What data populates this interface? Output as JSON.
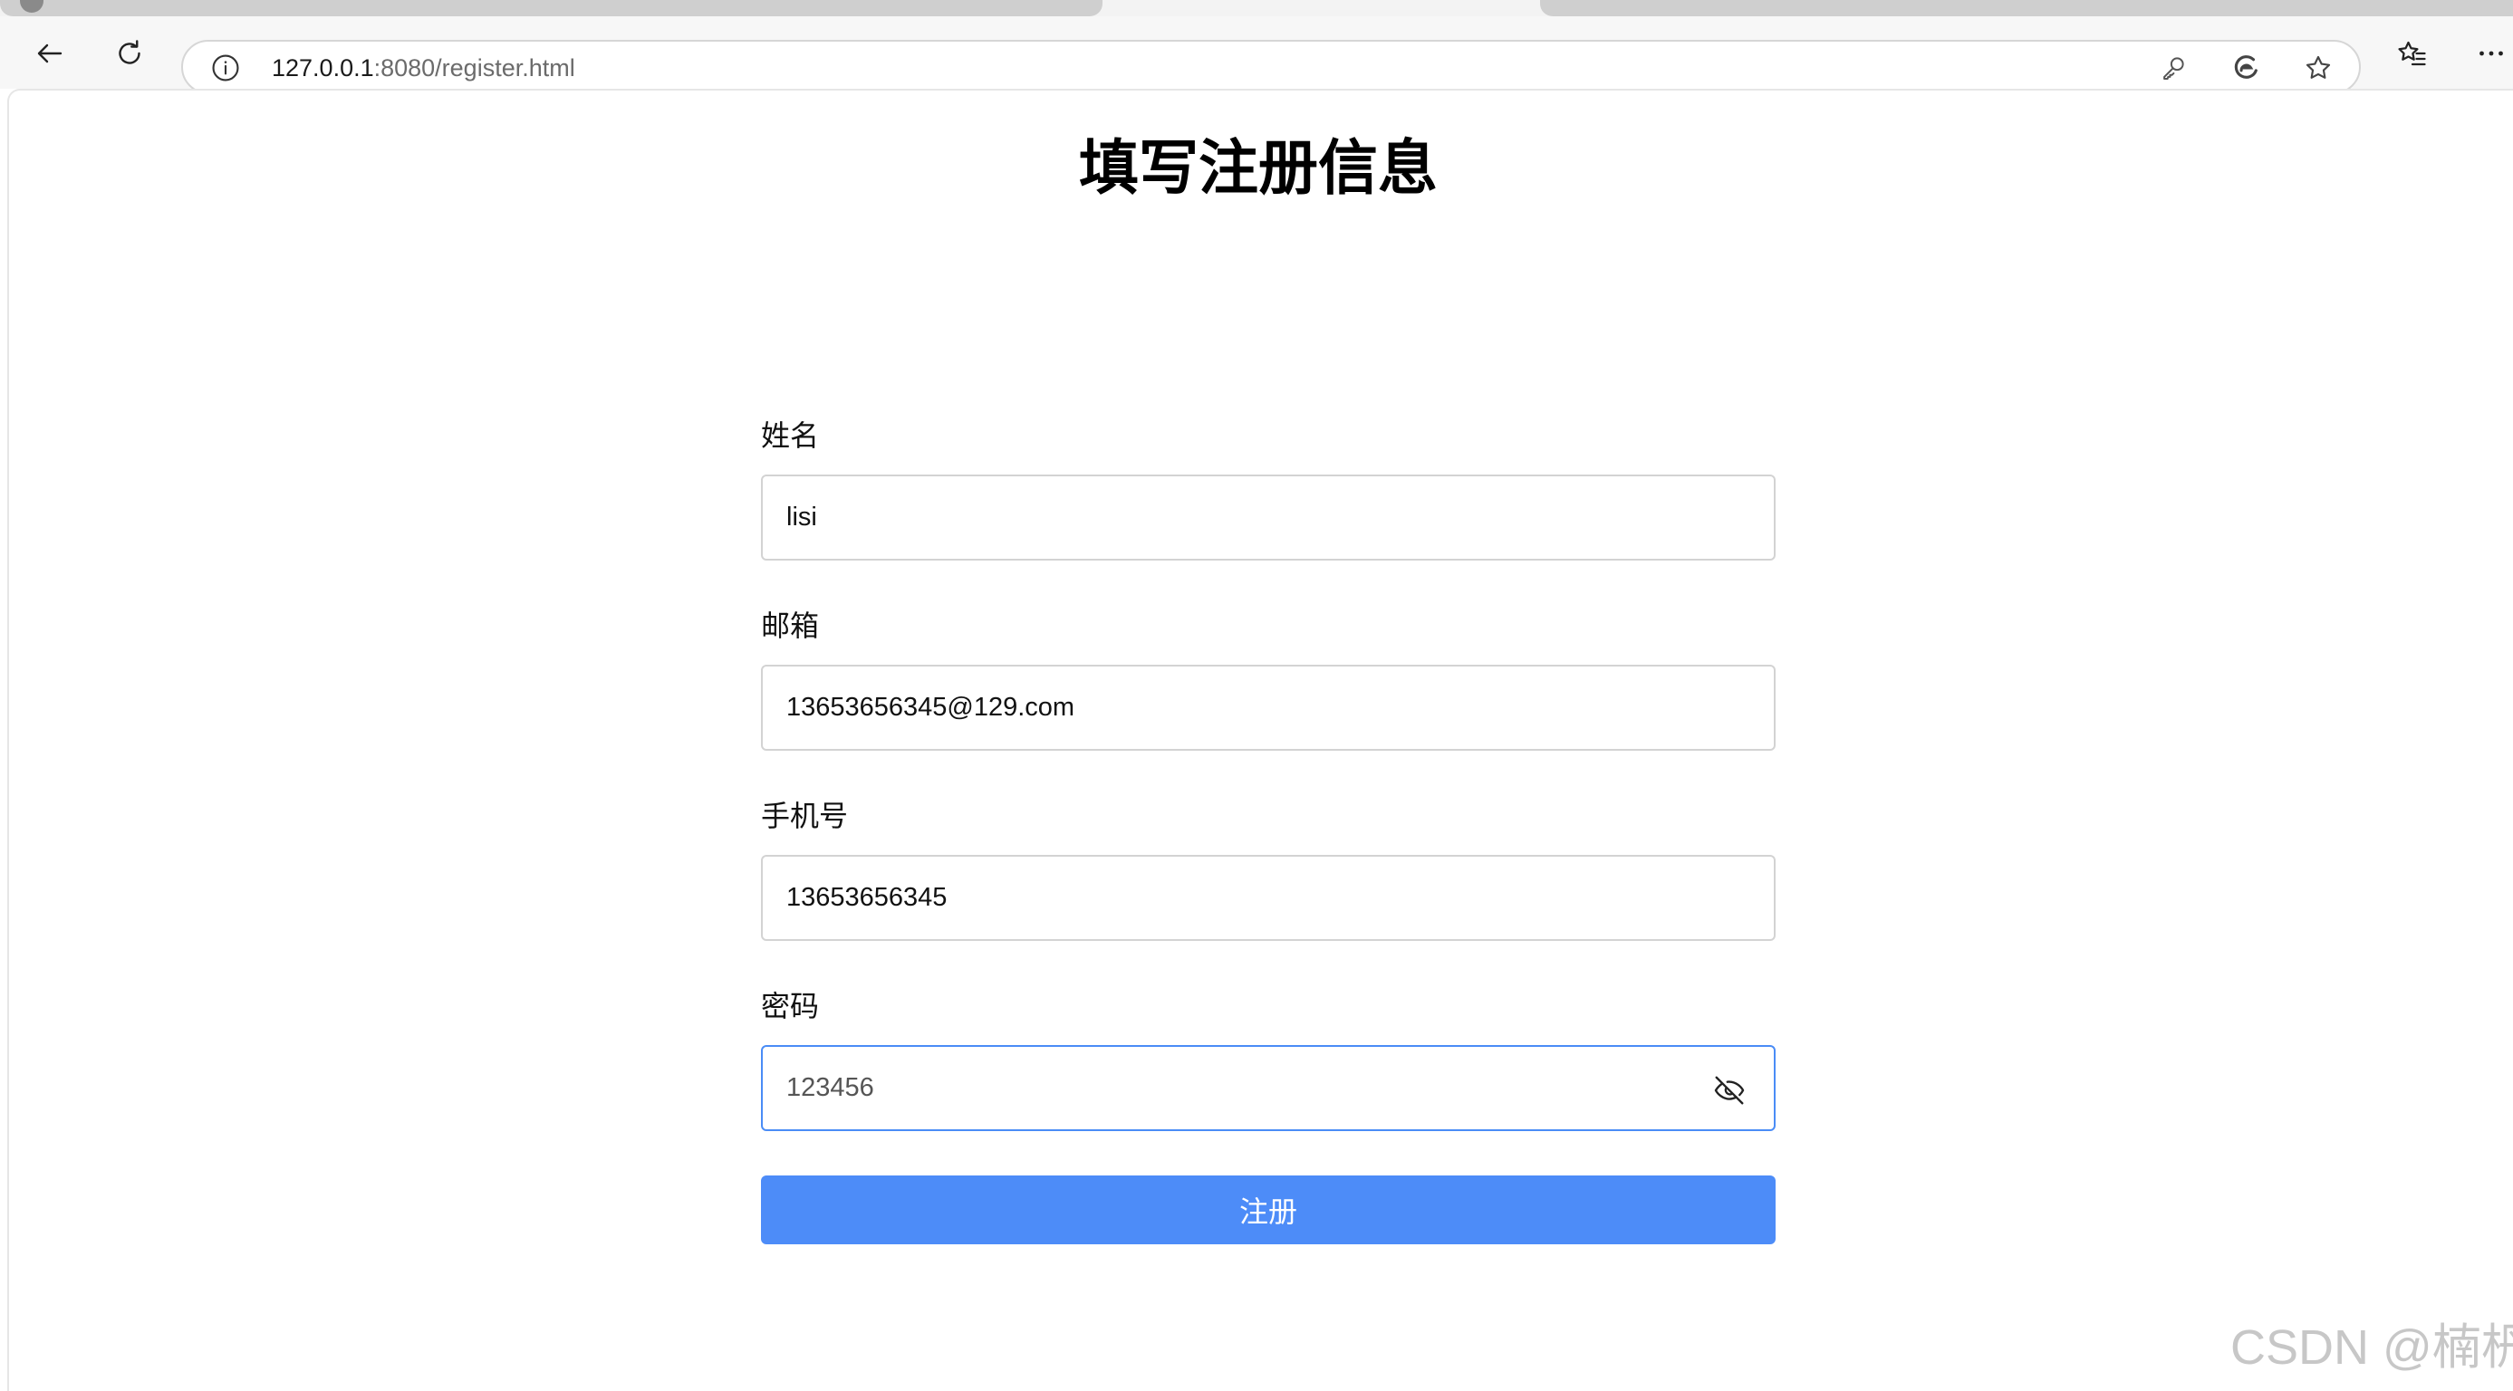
{
  "browser": {
    "url_host": "127.0.0.1",
    "url_rest": ":8080/register.html",
    "icons": {
      "back": "back-arrow-icon",
      "reload": "reload-icon",
      "info": "info-icon",
      "key": "key-icon",
      "edge": "edge-icon",
      "favorite": "star-icon",
      "favorites_list": "favorites-list-icon",
      "more": "more-icon"
    }
  },
  "page": {
    "title": "填写注册信息",
    "fields": [
      {
        "label": "姓名",
        "value": "lisi"
      },
      {
        "label": "邮箱",
        "value": "13653656345@129.com"
      },
      {
        "label": "手机号",
        "value": "13653656345"
      },
      {
        "label": "密码",
        "value": "123456"
      }
    ],
    "submit_label": "注册",
    "accent_color": "#4d8cf8"
  },
  "watermark": "CSDN @楠枬"
}
